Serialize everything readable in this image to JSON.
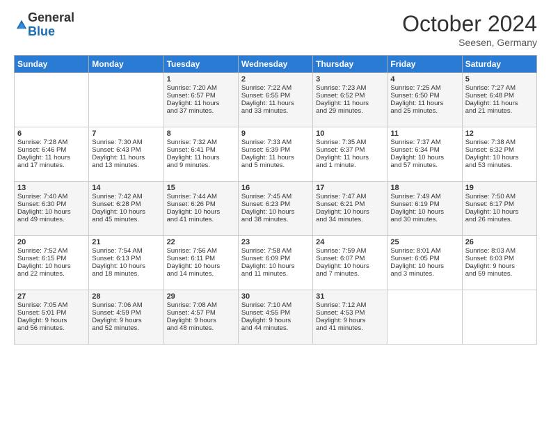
{
  "logo": {
    "general": "General",
    "blue": "Blue"
  },
  "title": "October 2024",
  "subtitle": "Seesen, Germany",
  "headers": [
    "Sunday",
    "Monday",
    "Tuesday",
    "Wednesday",
    "Thursday",
    "Friday",
    "Saturday"
  ],
  "weeks": [
    [
      {
        "day": "",
        "lines": []
      },
      {
        "day": "",
        "lines": []
      },
      {
        "day": "1",
        "lines": [
          "Sunrise: 7:20 AM",
          "Sunset: 6:57 PM",
          "Daylight: 11 hours",
          "and 37 minutes."
        ]
      },
      {
        "day": "2",
        "lines": [
          "Sunrise: 7:22 AM",
          "Sunset: 6:55 PM",
          "Daylight: 11 hours",
          "and 33 minutes."
        ]
      },
      {
        "day": "3",
        "lines": [
          "Sunrise: 7:23 AM",
          "Sunset: 6:52 PM",
          "Daylight: 11 hours",
          "and 29 minutes."
        ]
      },
      {
        "day": "4",
        "lines": [
          "Sunrise: 7:25 AM",
          "Sunset: 6:50 PM",
          "Daylight: 11 hours",
          "and 25 minutes."
        ]
      },
      {
        "day": "5",
        "lines": [
          "Sunrise: 7:27 AM",
          "Sunset: 6:48 PM",
          "Daylight: 11 hours",
          "and 21 minutes."
        ]
      }
    ],
    [
      {
        "day": "6",
        "lines": [
          "Sunrise: 7:28 AM",
          "Sunset: 6:46 PM",
          "Daylight: 11 hours",
          "and 17 minutes."
        ]
      },
      {
        "day": "7",
        "lines": [
          "Sunrise: 7:30 AM",
          "Sunset: 6:43 PM",
          "Daylight: 11 hours",
          "and 13 minutes."
        ]
      },
      {
        "day": "8",
        "lines": [
          "Sunrise: 7:32 AM",
          "Sunset: 6:41 PM",
          "Daylight: 11 hours",
          "and 9 minutes."
        ]
      },
      {
        "day": "9",
        "lines": [
          "Sunrise: 7:33 AM",
          "Sunset: 6:39 PM",
          "Daylight: 11 hours",
          "and 5 minutes."
        ]
      },
      {
        "day": "10",
        "lines": [
          "Sunrise: 7:35 AM",
          "Sunset: 6:37 PM",
          "Daylight: 11 hours",
          "and 1 minute."
        ]
      },
      {
        "day": "11",
        "lines": [
          "Sunrise: 7:37 AM",
          "Sunset: 6:34 PM",
          "Daylight: 10 hours",
          "and 57 minutes."
        ]
      },
      {
        "day": "12",
        "lines": [
          "Sunrise: 7:38 AM",
          "Sunset: 6:32 PM",
          "Daylight: 10 hours",
          "and 53 minutes."
        ]
      }
    ],
    [
      {
        "day": "13",
        "lines": [
          "Sunrise: 7:40 AM",
          "Sunset: 6:30 PM",
          "Daylight: 10 hours",
          "and 49 minutes."
        ]
      },
      {
        "day": "14",
        "lines": [
          "Sunrise: 7:42 AM",
          "Sunset: 6:28 PM",
          "Daylight: 10 hours",
          "and 45 minutes."
        ]
      },
      {
        "day": "15",
        "lines": [
          "Sunrise: 7:44 AM",
          "Sunset: 6:26 PM",
          "Daylight: 10 hours",
          "and 41 minutes."
        ]
      },
      {
        "day": "16",
        "lines": [
          "Sunrise: 7:45 AM",
          "Sunset: 6:23 PM",
          "Daylight: 10 hours",
          "and 38 minutes."
        ]
      },
      {
        "day": "17",
        "lines": [
          "Sunrise: 7:47 AM",
          "Sunset: 6:21 PM",
          "Daylight: 10 hours",
          "and 34 minutes."
        ]
      },
      {
        "day": "18",
        "lines": [
          "Sunrise: 7:49 AM",
          "Sunset: 6:19 PM",
          "Daylight: 10 hours",
          "and 30 minutes."
        ]
      },
      {
        "day": "19",
        "lines": [
          "Sunrise: 7:50 AM",
          "Sunset: 6:17 PM",
          "Daylight: 10 hours",
          "and 26 minutes."
        ]
      }
    ],
    [
      {
        "day": "20",
        "lines": [
          "Sunrise: 7:52 AM",
          "Sunset: 6:15 PM",
          "Daylight: 10 hours",
          "and 22 minutes."
        ]
      },
      {
        "day": "21",
        "lines": [
          "Sunrise: 7:54 AM",
          "Sunset: 6:13 PM",
          "Daylight: 10 hours",
          "and 18 minutes."
        ]
      },
      {
        "day": "22",
        "lines": [
          "Sunrise: 7:56 AM",
          "Sunset: 6:11 PM",
          "Daylight: 10 hours",
          "and 14 minutes."
        ]
      },
      {
        "day": "23",
        "lines": [
          "Sunrise: 7:58 AM",
          "Sunset: 6:09 PM",
          "Daylight: 10 hours",
          "and 11 minutes."
        ]
      },
      {
        "day": "24",
        "lines": [
          "Sunrise: 7:59 AM",
          "Sunset: 6:07 PM",
          "Daylight: 10 hours",
          "and 7 minutes."
        ]
      },
      {
        "day": "25",
        "lines": [
          "Sunrise: 8:01 AM",
          "Sunset: 6:05 PM",
          "Daylight: 10 hours",
          "and 3 minutes."
        ]
      },
      {
        "day": "26",
        "lines": [
          "Sunrise: 8:03 AM",
          "Sunset: 6:03 PM",
          "Daylight: 9 hours",
          "and 59 minutes."
        ]
      }
    ],
    [
      {
        "day": "27",
        "lines": [
          "Sunrise: 7:05 AM",
          "Sunset: 5:01 PM",
          "Daylight: 9 hours",
          "and 56 minutes."
        ]
      },
      {
        "day": "28",
        "lines": [
          "Sunrise: 7:06 AM",
          "Sunset: 4:59 PM",
          "Daylight: 9 hours",
          "and 52 minutes."
        ]
      },
      {
        "day": "29",
        "lines": [
          "Sunrise: 7:08 AM",
          "Sunset: 4:57 PM",
          "Daylight: 9 hours",
          "and 48 minutes."
        ]
      },
      {
        "day": "30",
        "lines": [
          "Sunrise: 7:10 AM",
          "Sunset: 4:55 PM",
          "Daylight: 9 hours",
          "and 44 minutes."
        ]
      },
      {
        "day": "31",
        "lines": [
          "Sunrise: 7:12 AM",
          "Sunset: 4:53 PM",
          "Daylight: 9 hours",
          "and 41 minutes."
        ]
      },
      {
        "day": "",
        "lines": []
      },
      {
        "day": "",
        "lines": []
      }
    ]
  ]
}
